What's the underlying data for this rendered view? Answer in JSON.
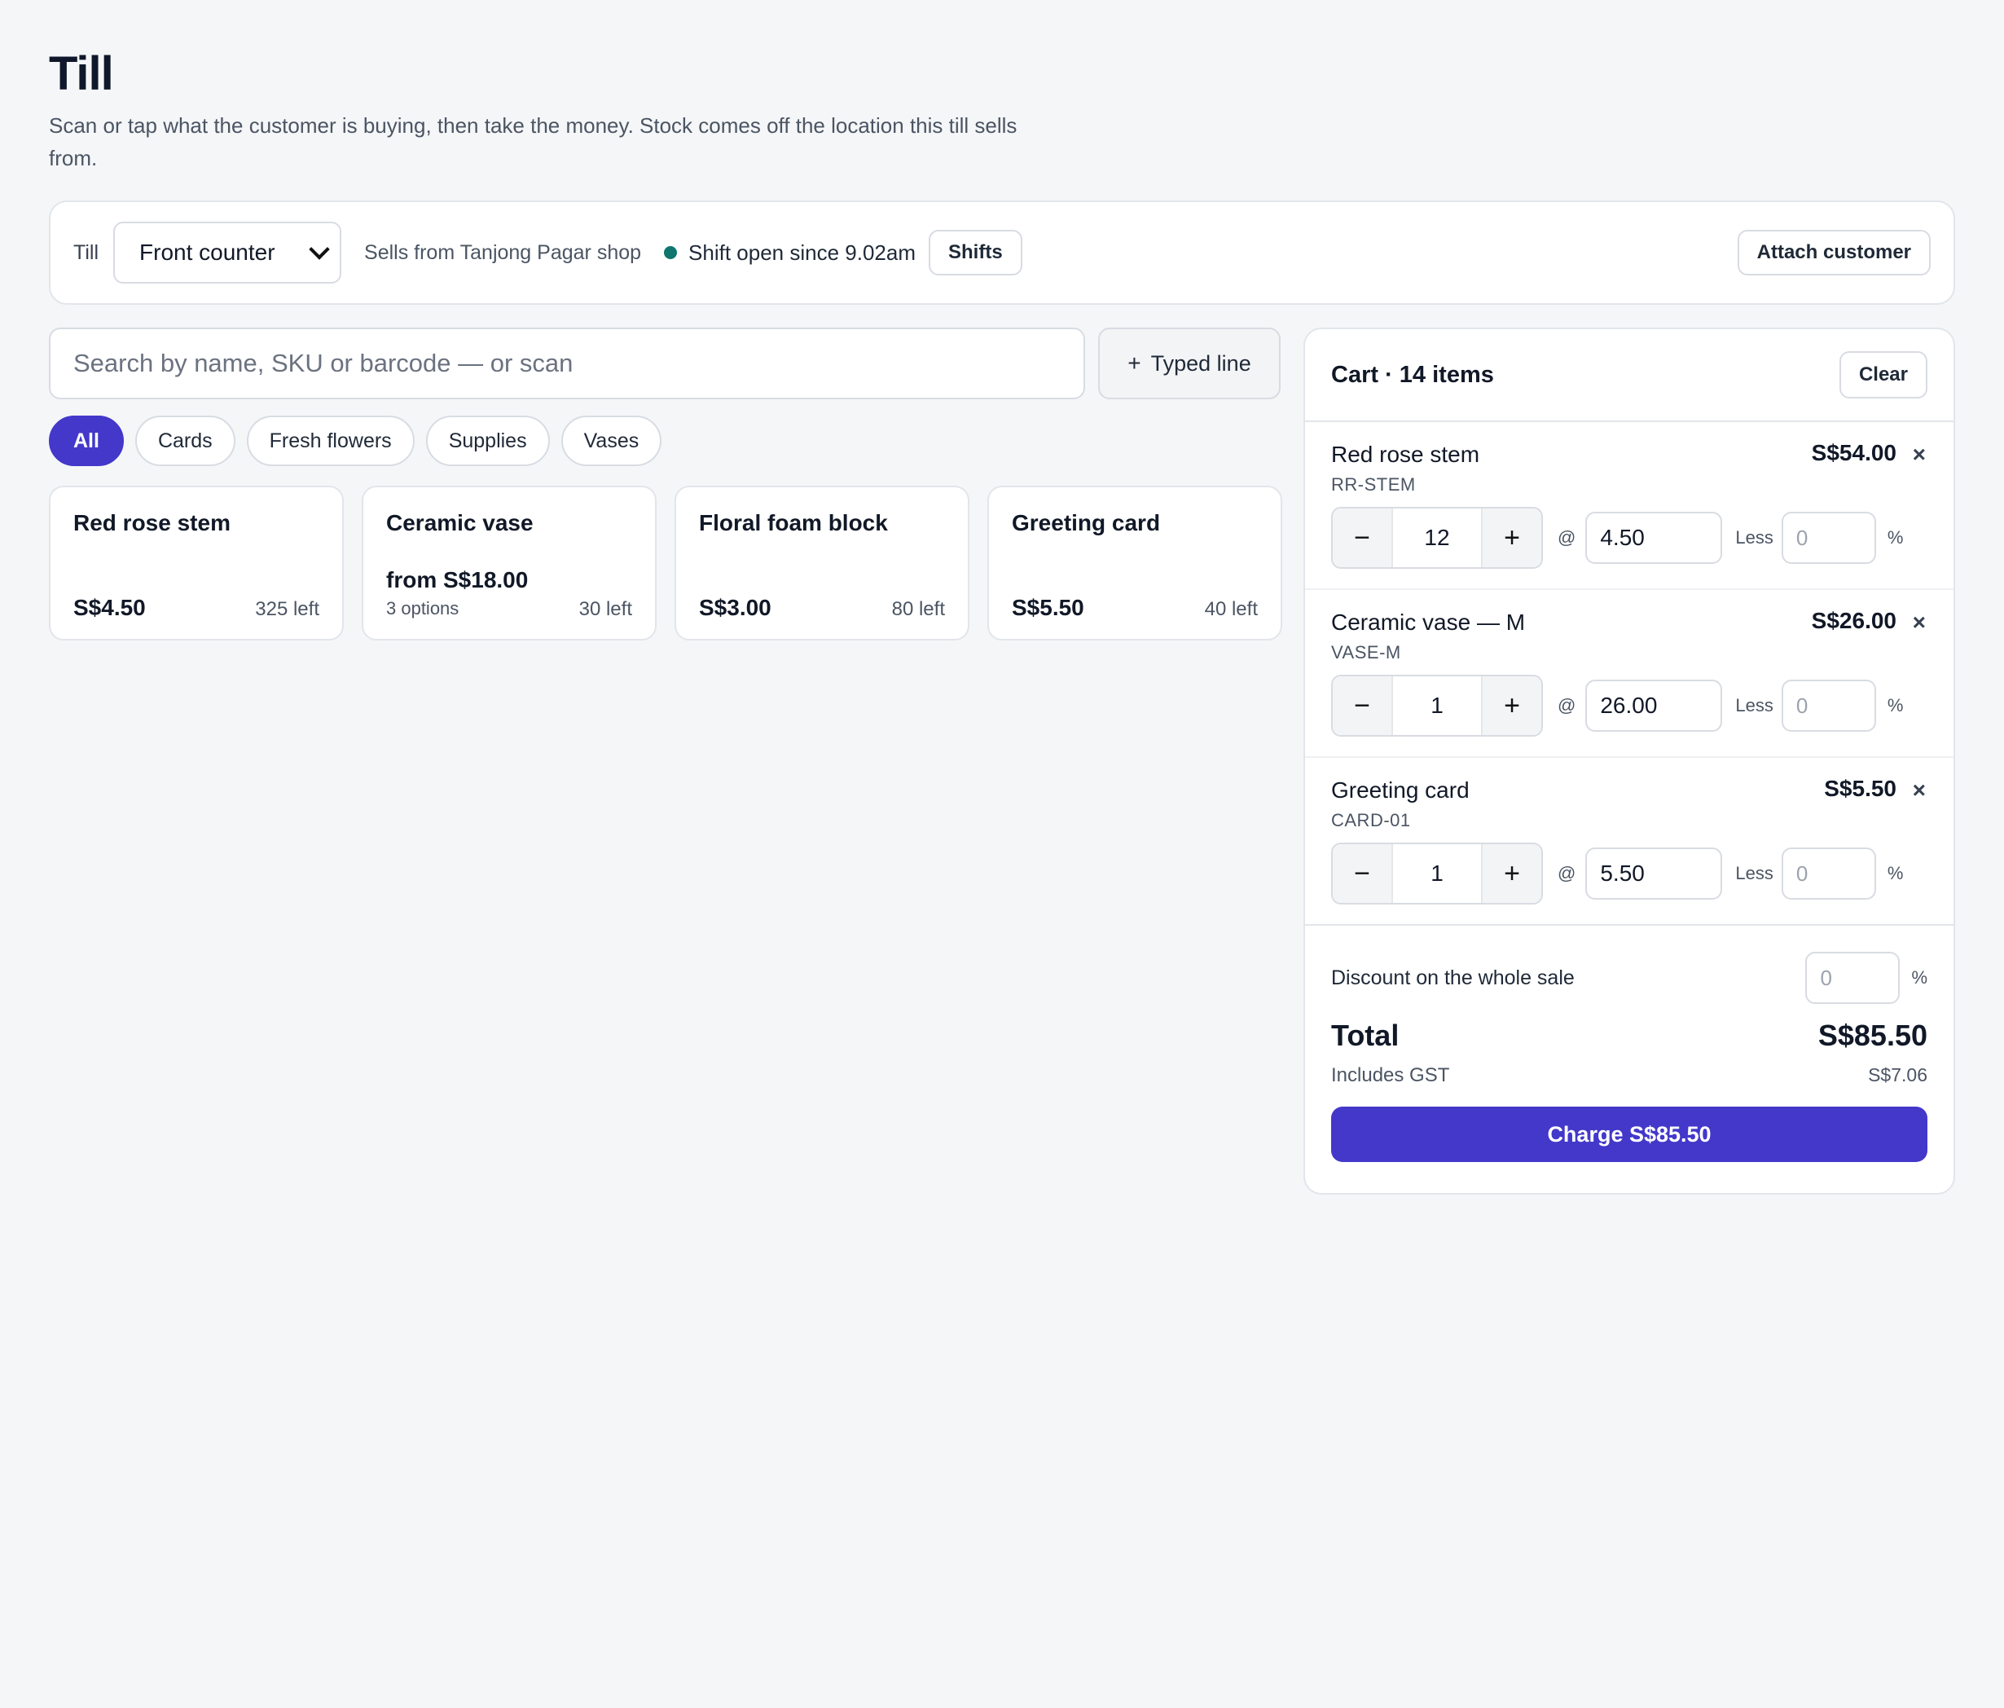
{
  "page": {
    "title": "Till",
    "subtitle": "Scan or tap what the customer is buying, then take the money. Stock comes off the location this till sells from."
  },
  "topbar": {
    "till_label": "Till",
    "till_select": "Front counter",
    "sells_from": "Sells from Tanjong Pagar shop",
    "shift_status": "Shift open since 9.02am",
    "shifts_button": "Shifts",
    "attach_customer_button": "Attach customer",
    "status_color": "#0f766e"
  },
  "search": {
    "placeholder": "Search by name, SKU or barcode — or scan",
    "typed_line_icon": "+",
    "typed_line_label": "Typed line"
  },
  "categories": [
    "All",
    "Cards",
    "Fresh flowers",
    "Supplies",
    "Vases"
  ],
  "active_category": "All",
  "products": [
    {
      "name": "Red rose stem",
      "price": "S$4.50",
      "stock": "325 left"
    },
    {
      "name": "Ceramic vase",
      "price": "from S$18.00",
      "options": "3 options",
      "stock": "30 left"
    },
    {
      "name": "Floral foam block",
      "price": "S$3.00",
      "stock": "80 left"
    },
    {
      "name": "Greeting card",
      "price": "S$5.50",
      "stock": "40 left"
    }
  ],
  "cart": {
    "title": "Cart · 14 items",
    "clear_button": "Clear",
    "at_symbol": "@",
    "less_label": "Less",
    "percent_symbol": "%",
    "remove_icon": "×",
    "minus_icon": "−",
    "plus_icon": "+",
    "lines": [
      {
        "name": "Red rose stem",
        "sku": "RR-STEM",
        "total": "S$54.00",
        "qty": "12",
        "unit_price": "4.50",
        "discount": "0"
      },
      {
        "name": "Ceramic vase — M",
        "sku": "VASE-M",
        "total": "S$26.00",
        "qty": "1",
        "unit_price": "26.00",
        "discount": "0"
      },
      {
        "name": "Greeting card",
        "sku": "CARD-01",
        "total": "S$5.50",
        "qty": "1",
        "unit_price": "5.50",
        "discount": "0"
      }
    ],
    "sale_discount_label": "Discount on the whole sale",
    "sale_discount": "0",
    "total_label": "Total",
    "total": "S$85.50",
    "gst_label": "Includes GST",
    "gst": "S$7.06",
    "charge_button": "Charge S$85.50",
    "accent_color": "#4338ca"
  }
}
